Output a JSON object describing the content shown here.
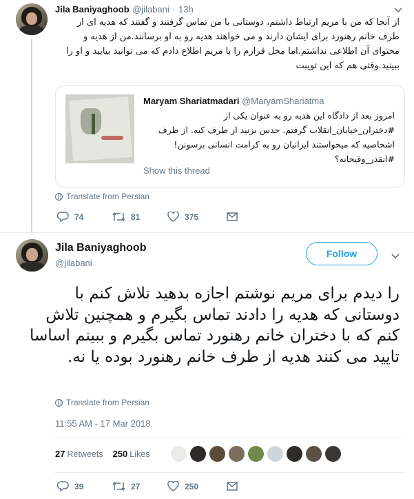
{
  "quoted_tweet_author": {
    "name": "Jila Baniyaghoob",
    "handle": "@jilabani",
    "time": "13h"
  },
  "first_tweet": {
    "text": "از آنجا که من با مریم ارتباط داشتم، دوستانی با من تماس گرفتند و گفتند که هدیه ای از طرف خانم رهنورد برای ایشان دارند و می خواهند هدیه رو به او برسانند.من از هدیه و محتوای آن اطلاعی نداشتم.اما محل قرارم را با مریم اطلاع دادم که می توانید بیایید و او را ببینید.وقتی هم که این تویبت",
    "translate": "Translate from Persian",
    "replies": "74",
    "retweets": "81",
    "likes": "375"
  },
  "quote": {
    "name": "Maryam Shariatmadari",
    "handle": "@MaryamShariatma",
    "text": "امروز بعد از دادگاه این هدیه رو به عنوان یکی از #دختران_خیابان_انقلاب گرفتم. حدس بزنید از طرف کیه. از طرف اشخاصیه که میخواستند ایرانیان رو به کرامت انسانی برسونن! #انقدر_وقیحانه؟",
    "show_thread": "Show this thread"
  },
  "main_tweet": {
    "name": "Jila Baniyaghoob",
    "handle": "@jilabani",
    "follow": "Follow",
    "text": "را دیدم برای مریم نوشتم اجازه بدهید تلاش کنم با دوستانی که هدیه را دادند تماس بگیرم و همچنین تلاش کنم که با دختران خانم رهنورد تماس بگیرم و ببینم اساسا تایید می کنند هدیه از طرف خانم رهنورد بوده یا نه.",
    "translate": "Translate from Persian",
    "timestamp": "11:55 AM - 17 Mar 2018",
    "retweets_count": "27",
    "retweets_label": "Retweets",
    "likes_count": "250",
    "likes_label": "Likes",
    "replies": "39",
    "retweets": "27",
    "likes": "250"
  },
  "icons": [
    "reply-icon",
    "retweet-icon",
    "like-icon",
    "message-icon",
    "globe-icon",
    "chevron-down-icon"
  ],
  "colors": {
    "accent": "#1da1f2",
    "muted": "#657786",
    "text": "#14171a",
    "border": "#e1e8ed",
    "thread_line": "#ccd6dd"
  },
  "liker_colors": [
    "#e9ece6",
    "#2f2a2a",
    "#5d4b3a",
    "#7a6d5a",
    "#6f8a4a",
    "#cfd5dc",
    "#2e2c28",
    "#5a5045",
    "#3a3735"
  ]
}
